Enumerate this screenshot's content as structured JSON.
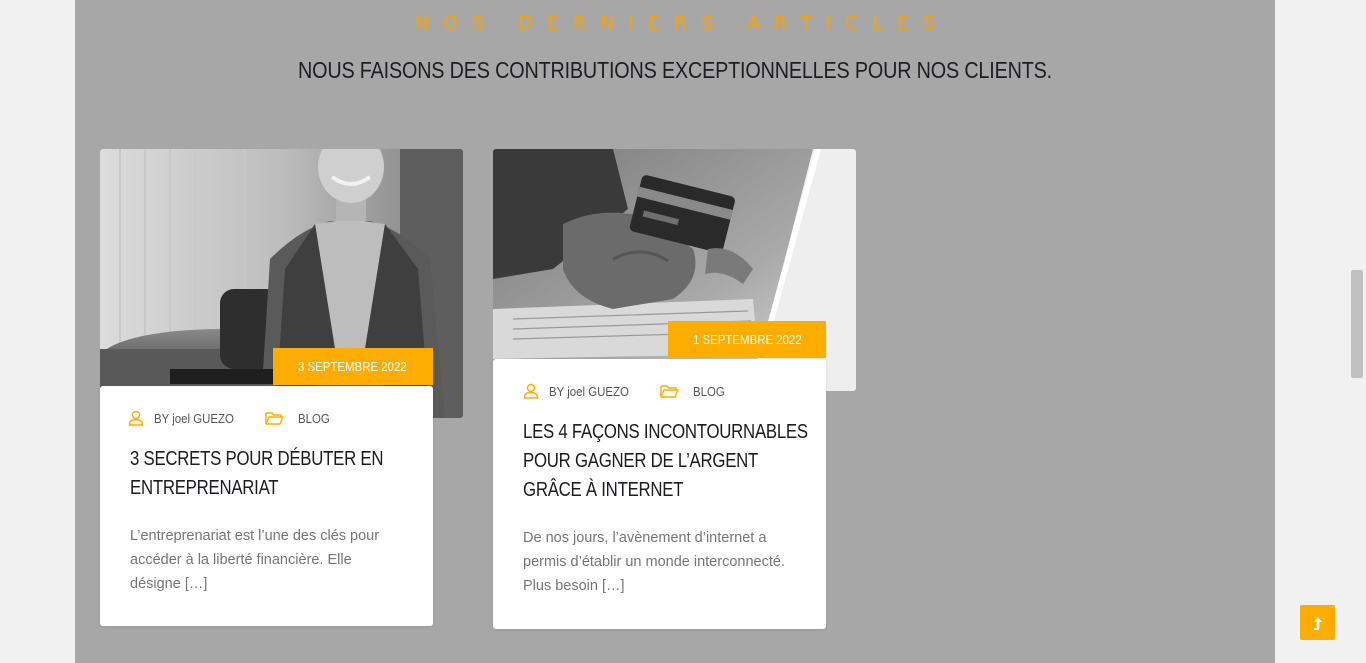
{
  "section": {
    "eyebrow": "NOS DERNIERS ARTICLES",
    "headline": "NOUS FAISONS DES CONTRIBUTIONS EXCEPTIONNELLES POUR NOS CLIENTS."
  },
  "colors": {
    "accent": "#fdac00",
    "section_bg": "#a7a7a7",
    "title": "#1b1b22"
  },
  "posts": [
    {
      "date": "3 SEPTEMBRE 2022",
      "author": "BY joel GUEZO",
      "category": "BLOG",
      "title": "3 SECRETS POUR DÉBUTER EN ENTREPRENARIAT",
      "excerpt": "L’entreprenariat est l’une des clés pour accéder à la liberté financière. Elle désigne […]",
      "image_icon": "businessman-photo"
    },
    {
      "date": "1 SEPTEMBRE 2022",
      "author": "BY joel GUEZO",
      "category": "BLOG",
      "title": "LES 4 FAÇONS INCONTOURNABLES POUR GAGNER DE L’ARGENT GRÂCE À INTERNET",
      "excerpt": "De nos jours, l’avènement d’internet a permis d’établir un monde interconnecté. Plus besoin […]",
      "image_icon": "credit-card-laptop-photo"
    }
  ],
  "icons": {
    "calendar": "calendar-icon",
    "user": "user-icon",
    "folder": "folder-icon",
    "scroll_top": "arrow-up-icon"
  }
}
